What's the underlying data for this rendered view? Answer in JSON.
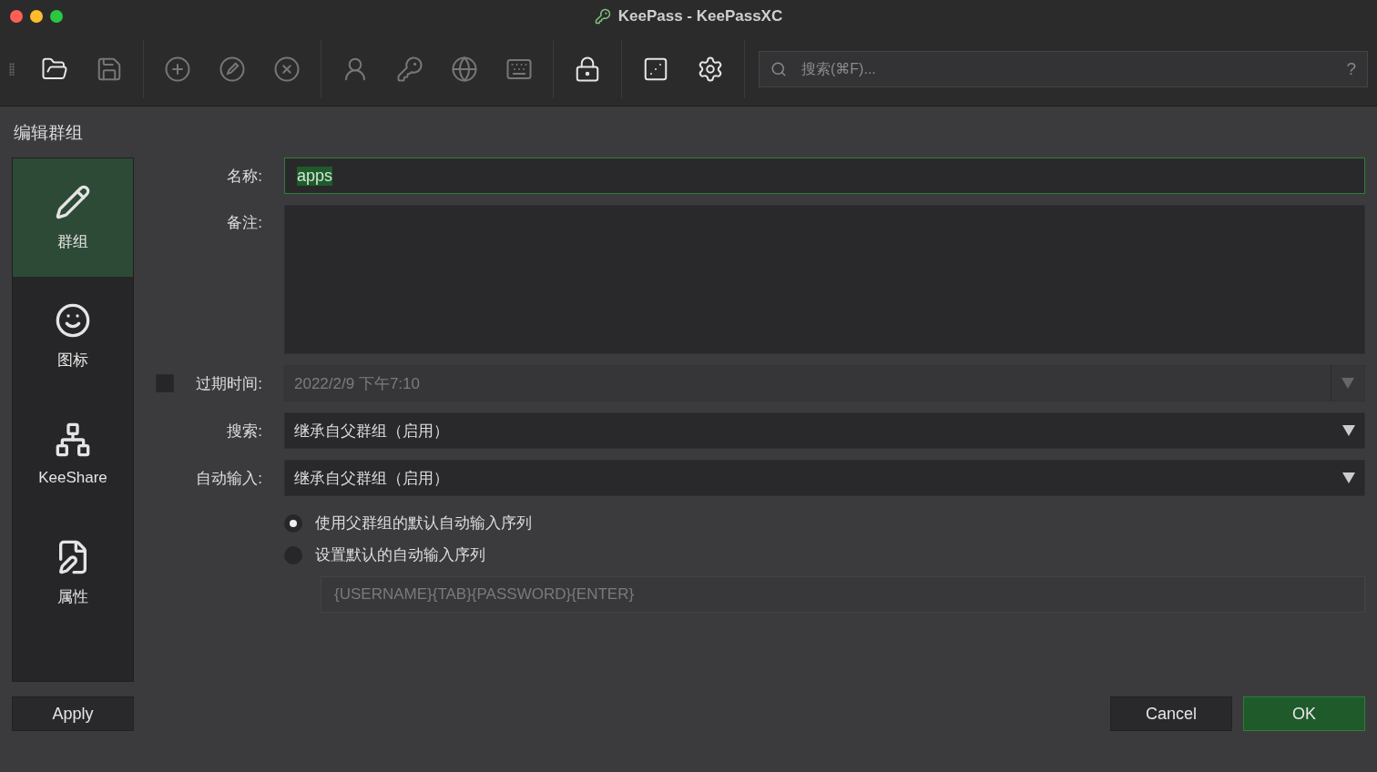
{
  "window": {
    "title": "KeePass - KeePassXC"
  },
  "toolbar": {
    "buttons": [
      {
        "disabled": false
      },
      {
        "disabled": true
      },
      {
        "disabled": true
      },
      {
        "disabled": true
      },
      {
        "disabled": true
      },
      {
        "disabled": true
      },
      {
        "disabled": true
      },
      {
        "disabled": true
      },
      {
        "disabled": true
      },
      {
        "disabled": false
      },
      {
        "disabled": false
      },
      {
        "disabled": false
      }
    ],
    "search": {
      "placeholder": "搜索(⌘F)...",
      "help": "?"
    }
  },
  "dialog": {
    "title": "编辑群组",
    "sidebar": [
      {
        "label": "群组",
        "selected": true
      },
      {
        "label": "图标",
        "selected": false
      },
      {
        "label": "KeeShare",
        "selected": false
      },
      {
        "label": "属性",
        "selected": false
      }
    ],
    "name": {
      "label": "名称:",
      "value": "apps"
    },
    "notes": {
      "label": "备注:"
    },
    "expires": {
      "label": "过期时间:",
      "checked": false,
      "value": "2022/2/9 下午7:10"
    },
    "search": {
      "label": "搜索:",
      "value": "继承自父群组（启用）"
    },
    "autotype": {
      "label": "自动输入:",
      "value": "继承自父群组（启用）"
    },
    "autotype_options": [
      {
        "label": "使用父群组的默认自动输入序列",
        "selected": true
      },
      {
        "label": "设置默认的自动输入序列",
        "selected": false
      }
    ],
    "sequence": {
      "value": "{USERNAME}{TAB}{PASSWORD}{ENTER}"
    },
    "buttons": {
      "apply": "Apply",
      "cancel": "Cancel",
      "ok": "OK"
    }
  }
}
